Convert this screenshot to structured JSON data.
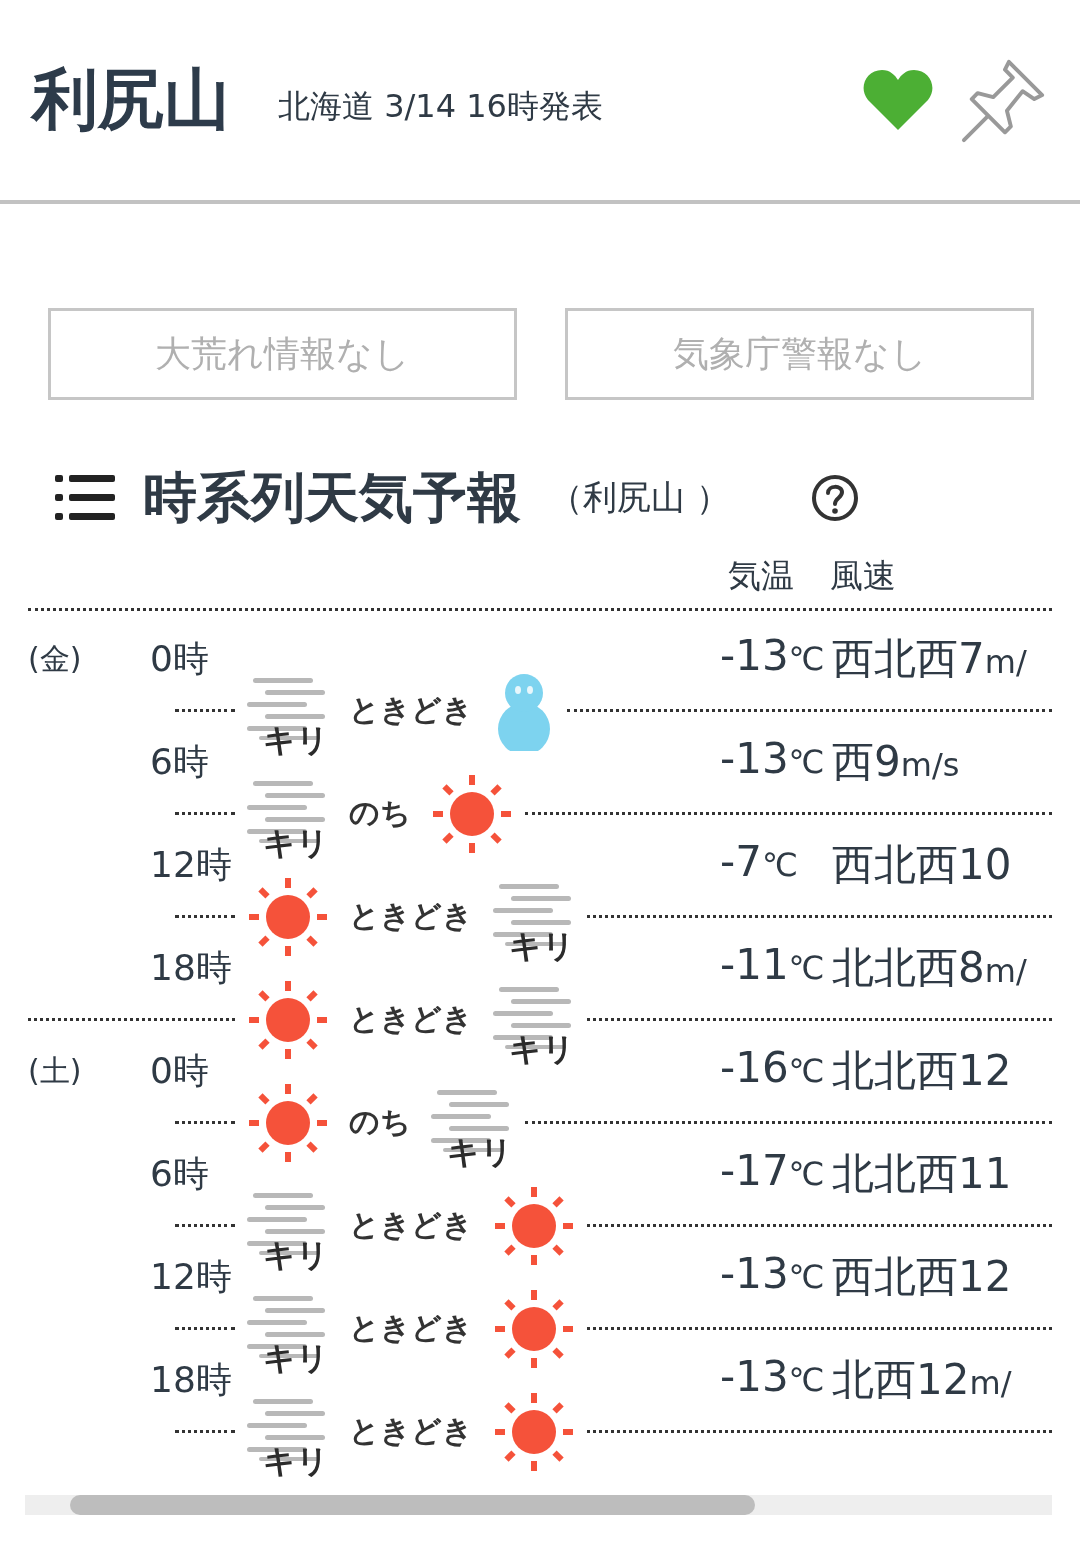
{
  "header": {
    "title": "利尻山",
    "subtitle": "北海道 3/14 16時発表",
    "favorite": true
  },
  "alerts": [
    "大荒れ情報なし",
    "気象庁警報なし"
  ],
  "section": {
    "title": "時系列天気予報",
    "location": "（利尻山 ）"
  },
  "columns": [
    "気温",
    "風速"
  ],
  "forecast": [
    {
      "day": "(金)",
      "time": "0時",
      "temp": "-13",
      "temp_unit": "℃",
      "wind_dir": "西北西",
      "wind_speed": "7",
      "wind_unit": "m/",
      "day_end": false,
      "weather": {
        "first": {
          "kind": "fog",
          "label": "キリ"
        },
        "connector": "ときどき",
        "second": {
          "kind": "snow"
        }
      }
    },
    {
      "time": "6時",
      "temp": "-13",
      "temp_unit": "℃",
      "wind_dir": "西",
      "wind_speed": "9",
      "wind_unit": "m/s",
      "day_end": false,
      "weather": {
        "first": {
          "kind": "fog",
          "label": "キリ"
        },
        "connector": "のち",
        "second": {
          "kind": "sun"
        }
      }
    },
    {
      "time": "12時",
      "temp": "-7",
      "temp_unit": "℃",
      "wind_dir": "西北西",
      "wind_speed": "10",
      "day_end": false,
      "weather": {
        "first": {
          "kind": "sun"
        },
        "connector": "ときどき",
        "second": {
          "kind": "fog",
          "label": "キリ"
        }
      }
    },
    {
      "time": "18時",
      "temp": "-11",
      "temp_unit": "℃",
      "wind_dir": "北北西",
      "wind_speed": "8",
      "wind_unit": "m/",
      "day_end": true,
      "weather": {
        "first": {
          "kind": "sun"
        },
        "connector": "ときどき",
        "second": {
          "kind": "fog",
          "label": "キリ"
        }
      }
    },
    {
      "day": "(土)",
      "time": "0時",
      "temp": "-16",
      "temp_unit": "℃",
      "wind_dir": "北北西",
      "wind_speed": "12",
      "day_end": false,
      "weather": {
        "first": {
          "kind": "sun"
        },
        "connector": "のち",
        "second": {
          "kind": "fog",
          "label": "キリ"
        }
      }
    },
    {
      "time": "6時",
      "temp": "-17",
      "temp_unit": "℃",
      "wind_dir": "北北西",
      "wind_speed": "11",
      "day_end": false,
      "weather": {
        "first": {
          "kind": "fog",
          "label": "キリ"
        },
        "connector": "ときどき",
        "second": {
          "kind": "sun"
        }
      }
    },
    {
      "time": "12時",
      "temp": "-13",
      "temp_unit": "℃",
      "wind_dir": "西北西",
      "wind_speed": "12",
      "day_end": false,
      "weather": {
        "first": {
          "kind": "fog",
          "label": "キリ"
        },
        "connector": "ときどき",
        "second": {
          "kind": "sun"
        }
      }
    },
    {
      "time": "18時",
      "temp": "-13",
      "temp_unit": "℃",
      "wind_dir": "北西",
      "wind_speed": "12",
      "wind_unit": "m/",
      "day_end": false,
      "weather": {
        "first": {
          "kind": "fog",
          "label": "キリ"
        },
        "connector": "ときどき",
        "second": {
          "kind": "sun"
        }
      }
    }
  ]
}
